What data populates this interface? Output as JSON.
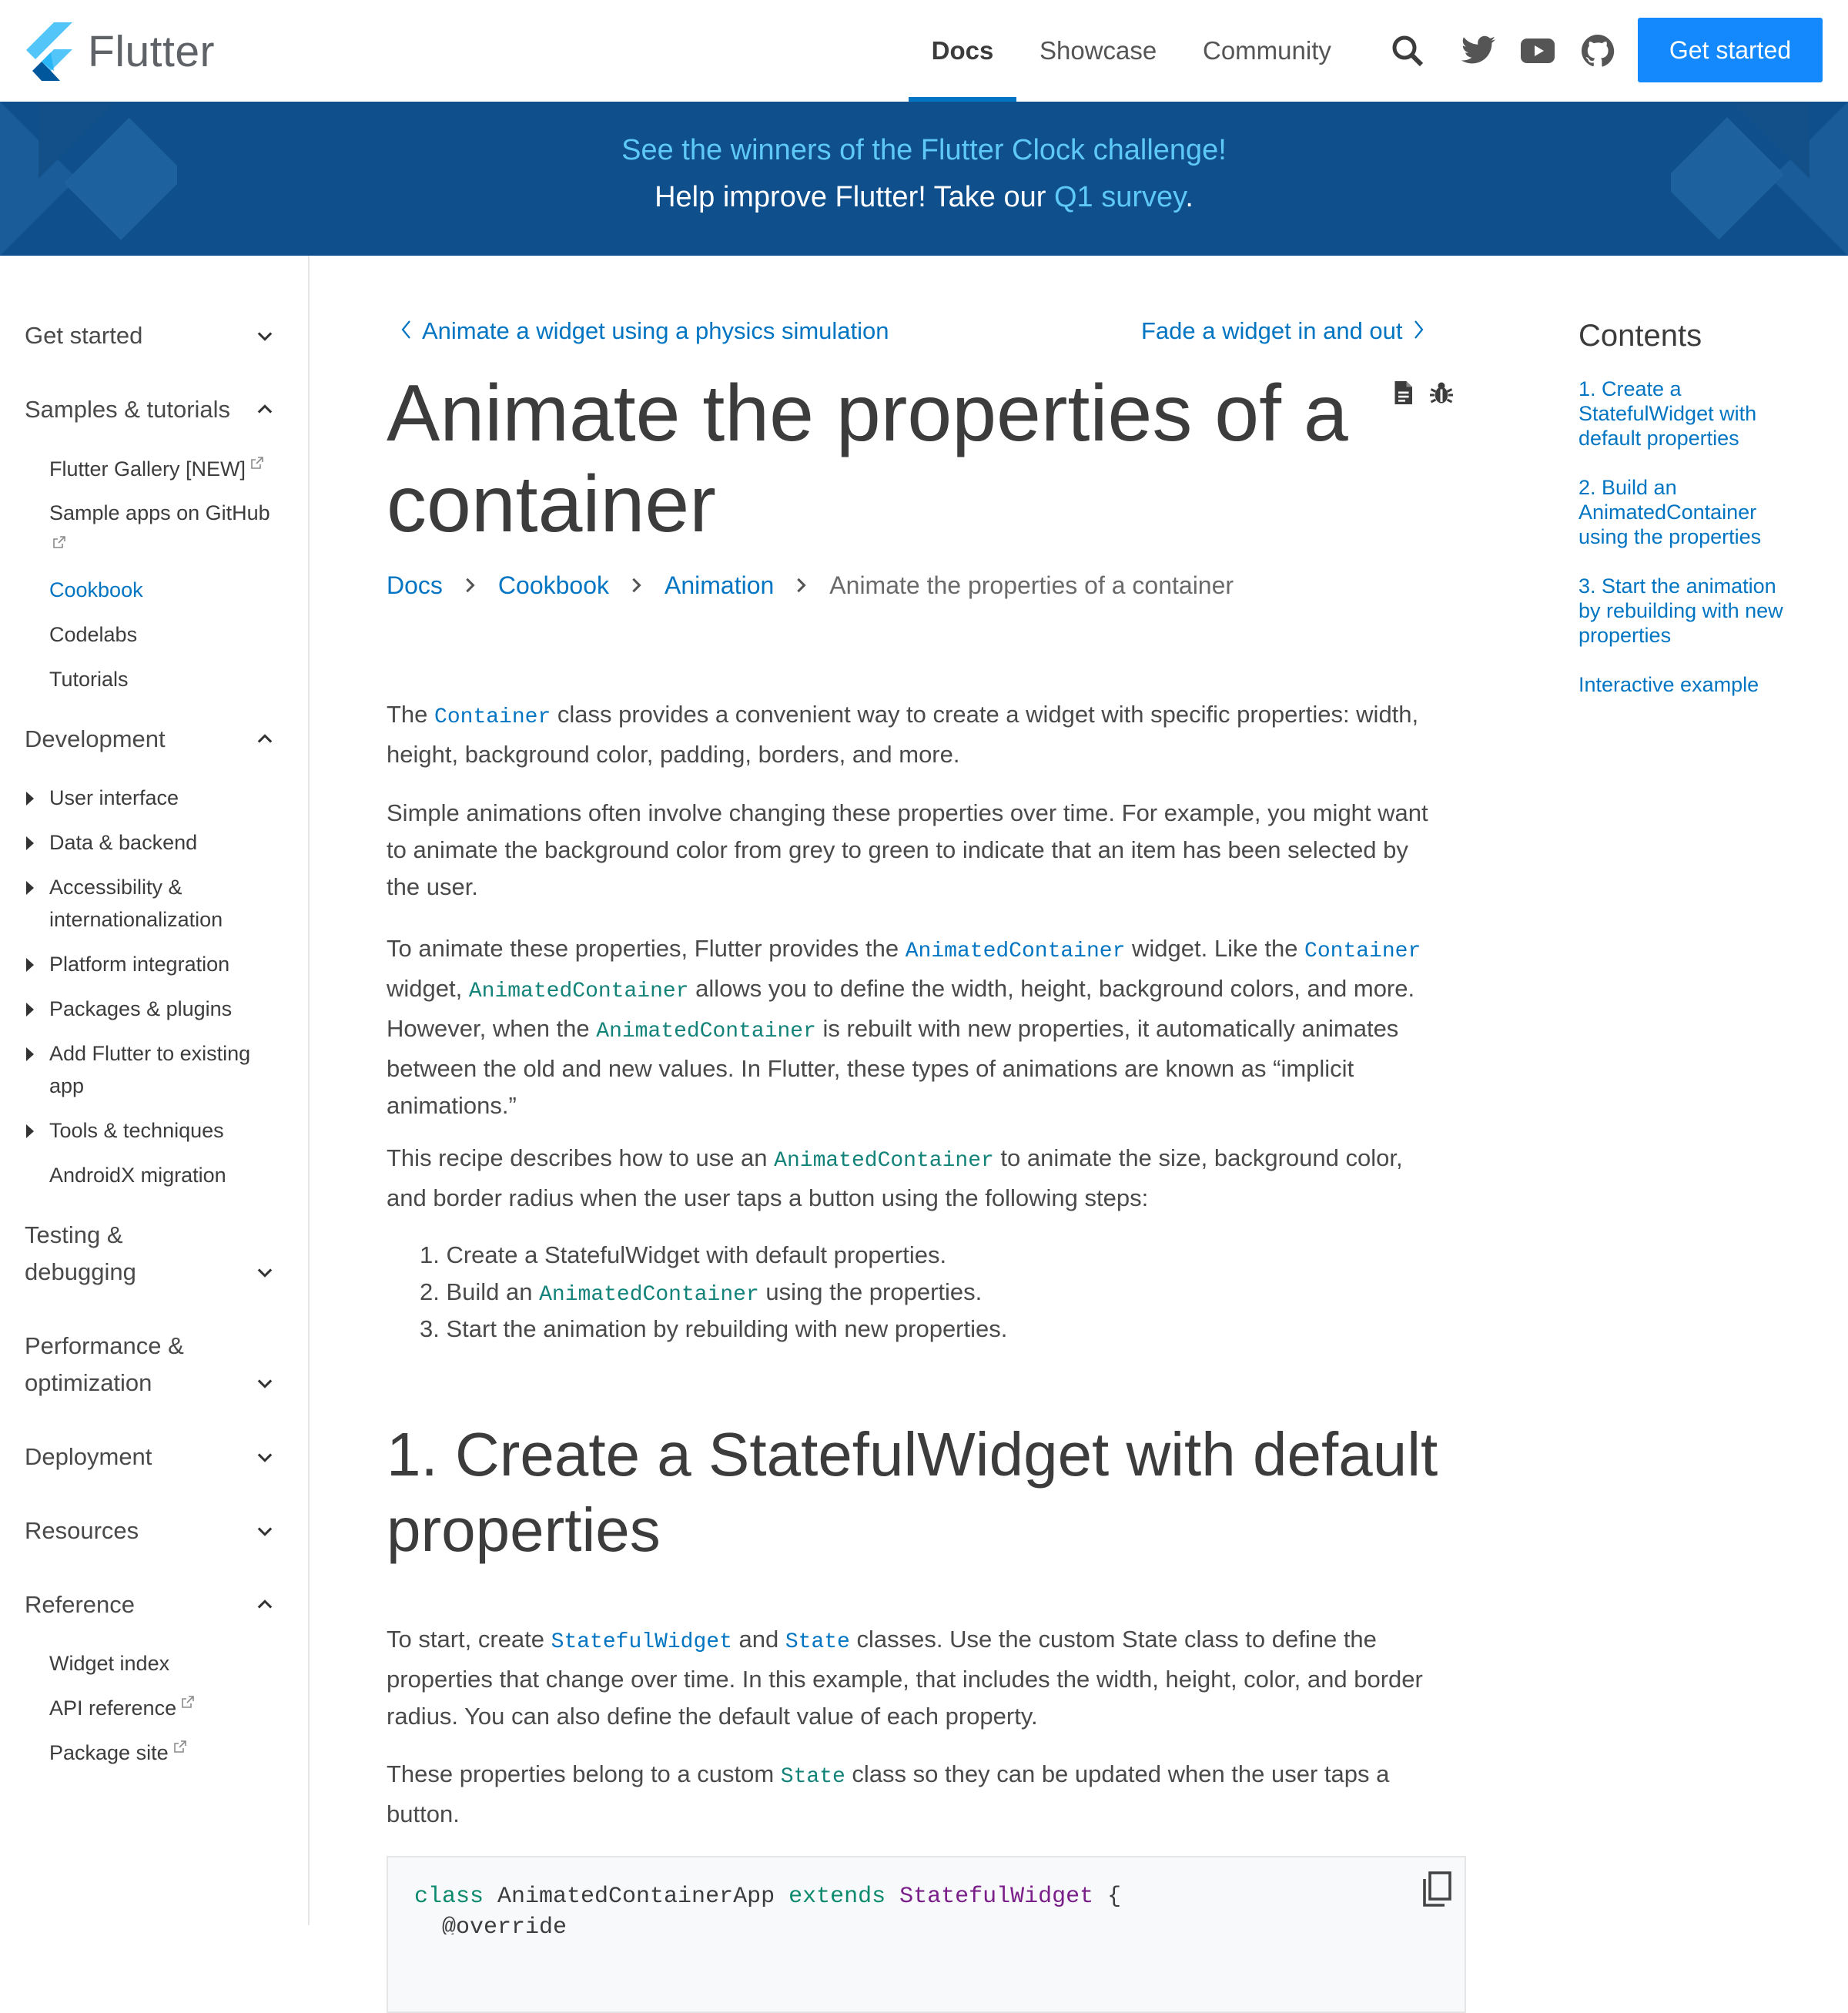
{
  "header": {
    "logo_text": "Flutter",
    "nav": [
      "Docs",
      "Showcase",
      "Community"
    ],
    "cta": "Get started",
    "icons": [
      "search-icon",
      "twitter-icon",
      "youtube-icon",
      "github-icon"
    ]
  },
  "banner": {
    "line1": "See the winners of the Flutter Clock challenge!",
    "line2_prefix": "Help improve Flutter! Take our ",
    "line2_link": "Q1 survey",
    "line2_suffix": "."
  },
  "sidebar": {
    "get_started": "Get started",
    "samples": "Samples & tutorials",
    "flutter_gallery": "Flutter Gallery [NEW]",
    "sample_apps": "Sample apps on GitHub",
    "cookbook": "Cookbook",
    "codelabs": "Codelabs",
    "tutorials": "Tutorials",
    "development": "Development",
    "user_interface": "User interface",
    "data_backend": "Data & backend",
    "a11y_1": "Accessibility &",
    "a11y_2": "internationalization",
    "platform": "Platform integration",
    "packages": "Packages & plugins",
    "add_flutter_1": "Add Flutter to existing",
    "add_flutter_2": "app",
    "tools": "Tools & techniques",
    "androidx": "AndroidX migration",
    "testing_1": "Testing &",
    "testing_2": "debugging",
    "perf_1": "Performance &",
    "perf_2": "optimization",
    "deployment": "Deployment",
    "resources": "Resources",
    "reference": "Reference",
    "widget_index": "Widget index",
    "api_reference": "API reference",
    "package_site": "Package site"
  },
  "main": {
    "prev": "Animate a widget using a physics simulation",
    "next": "Fade a widget in and out",
    "title_line1": "Animate the properties of a",
    "title_line2": "container",
    "breadcrumbs": [
      "Docs",
      "Cookbook",
      "Animation",
      "Animate the properties of a container"
    ],
    "p1": {
      "a": "The ",
      "code1": "Container",
      "b": " class provides a convenient way to create a widget with specific properties: width,",
      "line2": "height, background color, padding, borders, and more."
    },
    "p2": {
      "l1": "Simple animations often involve changing these properties over time. For example, you might want",
      "l2": "to animate the background color from grey to green to indicate that an item has been selected by",
      "l3": "the user."
    },
    "p3": {
      "a": "To animate these properties, Flutter provides the ",
      "code1": "AnimatedContainer",
      "b": " widget. Like the ",
      "code2": "Container",
      "c": "widget, ",
      "code3": "AnimatedContainer",
      "d": " allows you to define the width, height, background colors, and more.",
      "e": "However, when the ",
      "code4": "AnimatedContainer",
      "f": " is rebuilt with new properties, it automatically animates",
      "g": "between the old and new values. In Flutter, these types of animations are known as “implicit",
      "h": "animations.”"
    },
    "p4": {
      "a": "This recipe describes how to use an ",
      "code1": "AnimatedContainer",
      "b": " to animate the size, background color,",
      "line2": "and border radius when the user taps a button using the following steps:"
    },
    "steps": {
      "s1": "1. Create a StatefulWidget with default properties.",
      "s2a": "2. Build an ",
      "s2code": "AnimatedContainer",
      "s2b": " using the properties.",
      "s3": "3. Start the animation by rebuilding with new properties."
    },
    "h2_line1": "1. Create a StatefulWidget with default",
    "h2_line2": "properties",
    "p5": {
      "a": "To start, create ",
      "code1": "StatefulWidget",
      "b": " and ",
      "code2": "State",
      "c": " classes. Use the custom State class to define the",
      "l2": "properties that change over time. In this example, that includes the width, height, color, and border",
      "l3": "radius. You can also define the default value of each property."
    },
    "p6": {
      "a": "These properties belong to a custom ",
      "code1": "State",
      "b": " class so they can be updated when the user taps a",
      "l2": "button."
    },
    "code": {
      "kw1": "class",
      "name": " AnimatedContainerApp ",
      "kw2": "extends",
      "type": " StatefulWidget",
      "brace": " {",
      "line2": "  @override"
    }
  },
  "toc": {
    "title": "Contents",
    "i1": [
      "1. Create a",
      "StatefulWidget with",
      "default properties"
    ],
    "i2": [
      "2. Build an",
      "AnimatedContainer",
      "using the properties"
    ],
    "i3": [
      "3. Start the animation",
      "by rebuilding with new",
      "properties"
    ],
    "i4": "Interactive example"
  }
}
